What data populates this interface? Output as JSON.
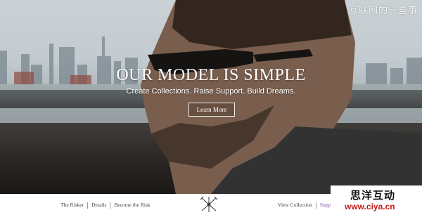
{
  "hero": {
    "headline": "OUR MODEL IS SIMPLE",
    "subheadline": "Create Collections. Raise Support. Build Dreams.",
    "cta_label": "Learn More"
  },
  "watermark": "互联网的一些事",
  "footer": {
    "left_links": [
      "The Risker",
      "Details",
      "Become the Risk"
    ],
    "right_links": [
      "View Collection",
      "Suppor"
    ],
    "accent_color": "#7b3fa0"
  },
  "badge": {
    "title": "思洋互动",
    "url": "www.ciya.cn"
  },
  "icons": {
    "logo": "crossed-arrows-logo-icon"
  }
}
